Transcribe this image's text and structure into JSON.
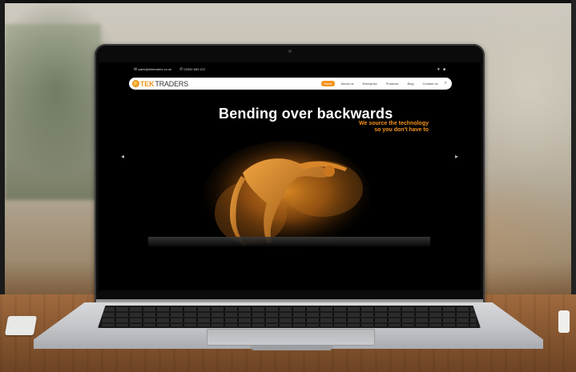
{
  "site": {
    "email": "sales@tektraders.co.uk",
    "phone": "02392 699 472",
    "social_icons": [
      "twitter-icon",
      "linkedin-icon"
    ],
    "logo": {
      "part1": "TEK",
      "part2": "TRADERS"
    },
    "nav": [
      {
        "label": "Home",
        "active": true
      },
      {
        "label": "About us",
        "active": false
      },
      {
        "label": "Enterprise",
        "active": false
      },
      {
        "label": "Products",
        "active": false
      },
      {
        "label": "Blog",
        "active": false
      },
      {
        "label": "Contact us",
        "active": false
      }
    ],
    "hero": {
      "headline": "Bending over backwards",
      "tagline_line1": "We source the technology",
      "tagline_line2": "so you don't have to"
    }
  },
  "colors": {
    "accent": "#f5931c",
    "screen_bg": "#000000"
  }
}
